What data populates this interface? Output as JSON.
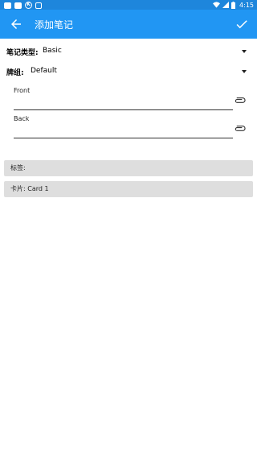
{
  "status_bar": {
    "time": "4:15",
    "left_icons": [
      "notification-icon",
      "notification-icon",
      "k-icon",
      "ankidroid-icon"
    ],
    "right_icons": [
      "wifi-icon",
      "signal-icon",
      "battery-icon"
    ]
  },
  "app_bar": {
    "title": "添加笔记",
    "back_icon": "arrow-back-icon",
    "confirm_icon": "check-icon",
    "color": "#2196f3"
  },
  "note_type": {
    "label": "笔记类型:",
    "value": "Basic"
  },
  "deck": {
    "label": "牌组:",
    "value": "Default"
  },
  "fields": [
    {
      "label": "Front",
      "value": ""
    },
    {
      "label": "Back",
      "value": ""
    }
  ],
  "tags_button": {
    "label": "标签:"
  },
  "cards_button": {
    "label": "卡片: Card 1"
  }
}
